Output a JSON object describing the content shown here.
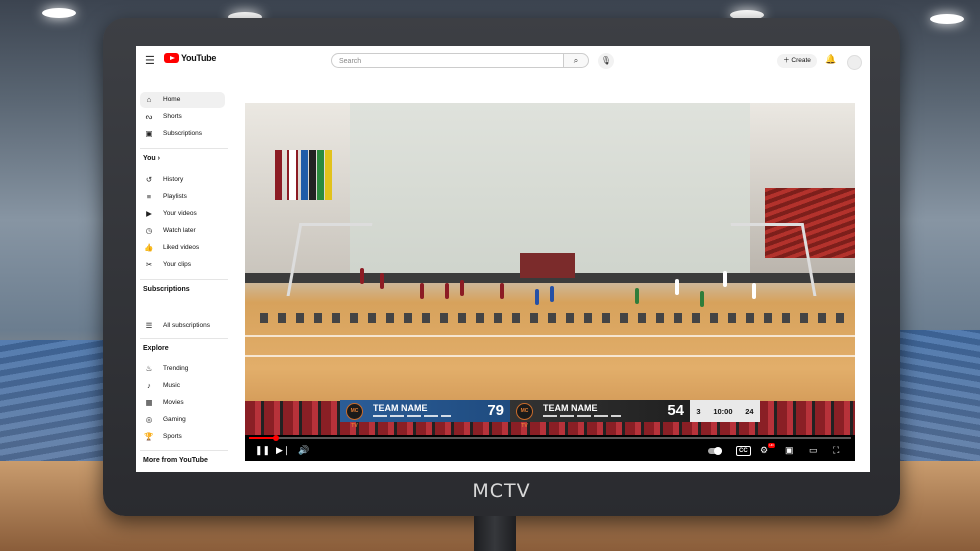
{
  "device_brand": "MCTV",
  "app": {
    "name": "YouTube"
  },
  "header": {
    "search_placeholder": "Search",
    "create_label": "Create"
  },
  "sidebar": {
    "main": [
      {
        "label": "Home",
        "icon": "home-icon"
      },
      {
        "label": "Shorts",
        "icon": "shorts-icon"
      },
      {
        "label": "Subscriptions",
        "icon": "subscriptions-icon"
      }
    ],
    "you_heading": "You",
    "you_chevron": "›",
    "you_items": [
      {
        "label": "History",
        "icon": "history-icon"
      },
      {
        "label": "Playlists",
        "icon": "playlists-icon"
      },
      {
        "label": "Your videos",
        "icon": "your-videos-icon"
      },
      {
        "label": "Watch later",
        "icon": "watch-later-icon"
      },
      {
        "label": "Liked videos",
        "icon": "liked-icon"
      },
      {
        "label": "Your clips",
        "icon": "clips-icon"
      }
    ],
    "subscriptions_heading": "Subscriptions",
    "all_subscriptions": "All subscriptions",
    "explore_heading": "Explore",
    "explore_items": [
      {
        "label": "Trending",
        "icon": "trending-icon"
      },
      {
        "label": "Music",
        "icon": "music-icon"
      },
      {
        "label": "Movies",
        "icon": "movies-icon"
      },
      {
        "label": "Gaming",
        "icon": "gaming-icon"
      },
      {
        "label": "Sports",
        "icon": "sports-icon"
      }
    ],
    "more_heading": "More from YouTube"
  },
  "scoreboard": {
    "team_a": {
      "logo": "MC TV",
      "name": "TEAM NAME",
      "score": "79"
    },
    "team_b": {
      "logo": "MC TV",
      "name": "TEAM NAME",
      "score": "54"
    },
    "period": "3",
    "game_clock": "10:00",
    "shot_clock": "24"
  },
  "player": {
    "progress_fraction": 0.045,
    "hd_badge": "HD"
  },
  "colors": {
    "youtube_red": "#ff0000",
    "team_a_color": "#2b5d97",
    "team_b_color": "#2a2a2a"
  }
}
